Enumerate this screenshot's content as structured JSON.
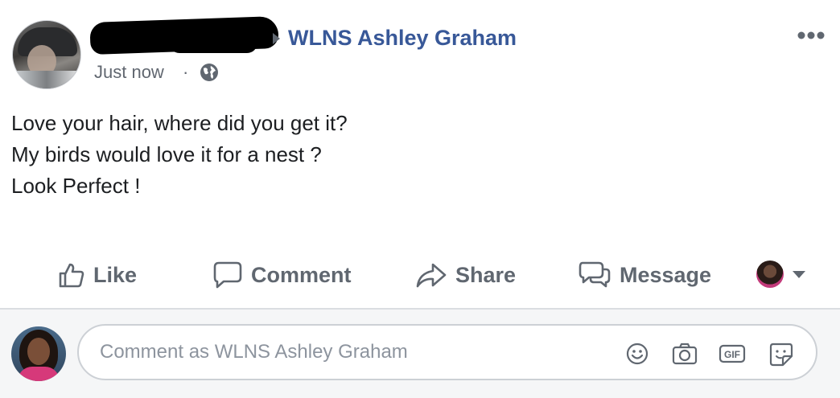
{
  "post": {
    "page_name": "WLNS Ashley Graham",
    "timestamp": "Just now",
    "separator": "·",
    "privacy_icon": "globe-icon",
    "menu_icon": "more-options-icon",
    "text_lines": [
      "Love your hair, where did you get it?",
      "My birds would love it for a nest ?",
      "Look Perfect !"
    ]
  },
  "actions": {
    "like": "Like",
    "comment": "Comment",
    "share": "Share",
    "message": "Message"
  },
  "composer": {
    "placeholder": "Comment as WLNS Ashley Graham",
    "icons": [
      "emoji-icon",
      "camera-icon",
      "gif-icon",
      "sticker-icon"
    ],
    "gif_label": "GIF"
  },
  "colors": {
    "link": "#385898",
    "muted": "#606770",
    "text": "#1c1e21",
    "divider": "#dadde1"
  }
}
